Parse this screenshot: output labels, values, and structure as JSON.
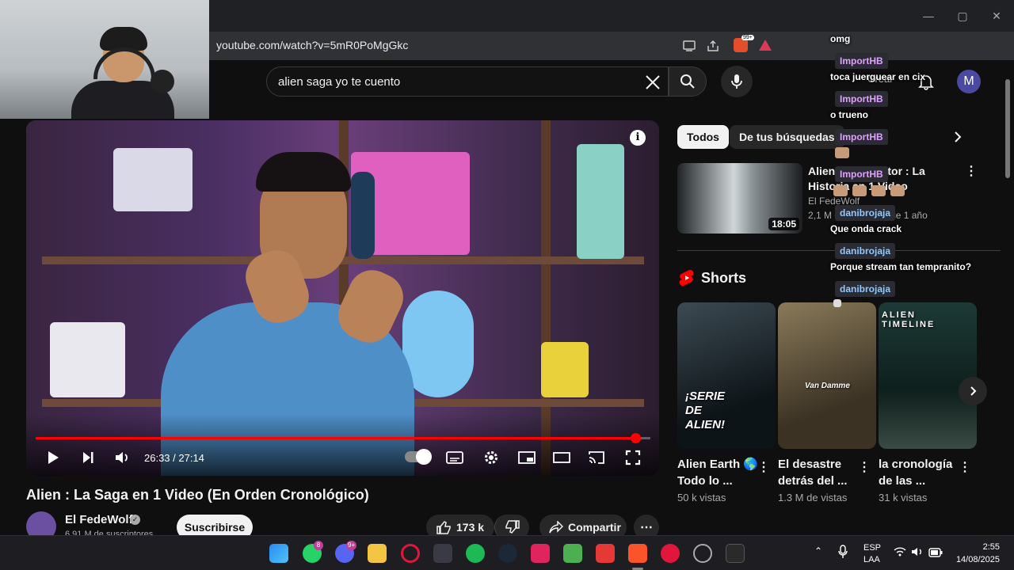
{
  "browser": {
    "url": "youtube.com/watch?v=5mR0PoMgGkc",
    "extension_badge": "99+"
  },
  "search": {
    "query": "alien saga yo te cuento"
  },
  "header": {
    "create_label": "Crear",
    "avatar_letter": "M"
  },
  "player": {
    "time": "26:33 / 27:14",
    "progress_fraction": 0.975
  },
  "video": {
    "title": "Alien : La Saga en 1 Video (En Orden Cronológico)",
    "channel": "El FedeWolf",
    "subscribers": "6,91 M de suscriptores",
    "subscribe_label": "Suscribirse",
    "likes": "173 k",
    "share_label": "Compartir"
  },
  "chips": {
    "all": "Todos",
    "from_searches": "De tus búsquedas"
  },
  "recommended": {
    "title": "Alien vs. Predator : La Historia en 1 Video",
    "channel": "El FedeWolf",
    "meta": "2,1 M de vistas · hace 1 año",
    "duration": "18:05"
  },
  "shorts": {
    "heading": "Shorts",
    "items": [
      {
        "title": "Alien Earth 🌎 Todo lo ...",
        "views": "50 k vistas",
        "caption": "¡SERIE DE ALIEN!"
      },
      {
        "title": "El desastre detrás del ...",
        "views": "1.3 M de vistas",
        "caption": "Van Damme"
      },
      {
        "title": "la cronología de las ...",
        "views": "31 k vistas",
        "caption": "ALIEN TIMELINE"
      }
    ]
  },
  "chat": {
    "messages": [
      {
        "user": "",
        "text": "omg"
      },
      {
        "user": "ImportHB",
        "text": "toca juerguear en cix"
      },
      {
        "user": "ImportHB",
        "text": "o trueno"
      },
      {
        "user": "ImportHB",
        "text": ""
      },
      {
        "user": "ImportHB",
        "text": ""
      },
      {
        "user": "danibrojaja",
        "text": "Que onda crack"
      },
      {
        "user": "danibrojaja",
        "text": "Porque stream tan tempranito?"
      },
      {
        "user": "danibrojaja",
        "text": ""
      }
    ]
  },
  "taskbar": {
    "whatsapp_badge": "8",
    "discord_badge": "9+",
    "lang_line1": "ESP",
    "lang_line2": "LAA",
    "time": "2:55",
    "date": "14/08/2025"
  },
  "colors": {
    "accent": "#ff0000",
    "background": "#0f0f0f",
    "surface": "#272727"
  }
}
